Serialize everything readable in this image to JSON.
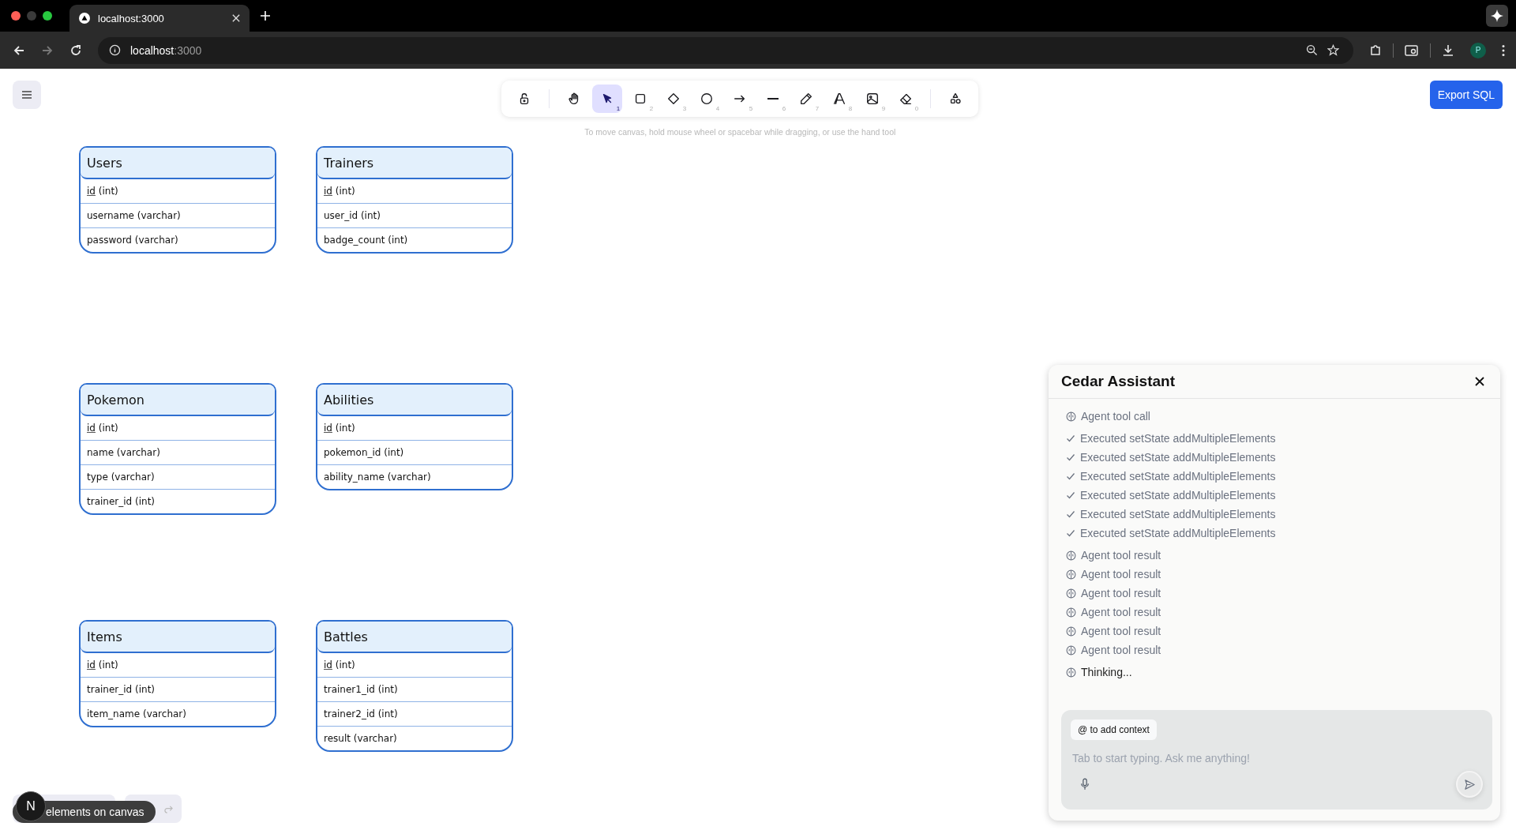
{
  "browser": {
    "tab_title": "localhost:3000",
    "url_host": "localhost",
    "url_port": ":3000",
    "profile_initial": "P"
  },
  "toolbar": {
    "tools": [
      {
        "kind": "lock",
        "selected": false
      },
      {
        "kind": "divider"
      },
      {
        "kind": "hand",
        "selected": false
      },
      {
        "kind": "select",
        "key": "1",
        "selected": true
      },
      {
        "kind": "rectangle",
        "key": "2",
        "selected": false
      },
      {
        "kind": "diamond",
        "key": "3",
        "selected": false
      },
      {
        "kind": "ellipse",
        "key": "4",
        "selected": false
      },
      {
        "kind": "arrow",
        "key": "5",
        "selected": false
      },
      {
        "kind": "line",
        "key": "6",
        "selected": false
      },
      {
        "kind": "pencil",
        "key": "7",
        "selected": false
      },
      {
        "kind": "text",
        "key": "8",
        "selected": false
      },
      {
        "kind": "image",
        "key": "9",
        "selected": false
      },
      {
        "kind": "eraser",
        "key": "0",
        "selected": false
      },
      {
        "kind": "divider"
      },
      {
        "kind": "shapes",
        "selected": false
      }
    ],
    "hint": "To move canvas, hold mouse wheel or spacebar while dragging, or use the hand tool"
  },
  "export_button": "Export SQL",
  "tables": [
    {
      "name": "Users",
      "fields": [
        {
          "name": "id",
          "type": "(int)",
          "primary_key": true
        },
        {
          "name": "username",
          "type": "(varchar)",
          "primary_key": false
        },
        {
          "name": "password",
          "type": "(varchar)",
          "primary_key": false
        }
      ]
    },
    {
      "name": "Trainers",
      "fields": [
        {
          "name": "id",
          "type": "(int)",
          "primary_key": true
        },
        {
          "name": "user_id",
          "type": "(int)",
          "primary_key": false
        },
        {
          "name": "badge_count",
          "type": "(int)",
          "primary_key": false
        }
      ]
    },
    {
      "name": "Pokemon",
      "fields": [
        {
          "name": "id",
          "type": "(int)",
          "primary_key": true
        },
        {
          "name": "name",
          "type": "(varchar)",
          "primary_key": false
        },
        {
          "name": "type",
          "type": "(varchar)",
          "primary_key": false
        },
        {
          "name": "trainer_id",
          "type": "(int)",
          "primary_key": false
        }
      ]
    },
    {
      "name": "Abilities",
      "fields": [
        {
          "name": "id",
          "type": "(int)",
          "primary_key": true
        },
        {
          "name": "pokemon_id",
          "type": "(int)",
          "primary_key": false
        },
        {
          "name": "ability_name",
          "type": "(varchar)",
          "primary_key": false
        }
      ]
    },
    {
      "name": "Items",
      "fields": [
        {
          "name": "id",
          "type": "(int)",
          "primary_key": true
        },
        {
          "name": "trainer_id",
          "type": "(int)",
          "primary_key": false
        },
        {
          "name": "item_name",
          "type": "(varchar)",
          "primary_key": false
        }
      ]
    },
    {
      "name": "Battles",
      "fields": [
        {
          "name": "id",
          "type": "(int)",
          "primary_key": true
        },
        {
          "name": "trainer1_id",
          "type": "(int)",
          "primary_key": false
        },
        {
          "name": "trainer2_id",
          "type": "(int)",
          "primary_key": false
        },
        {
          "name": "result",
          "type": "(varchar)",
          "primary_key": false
        }
      ]
    }
  ],
  "assistant": {
    "title": "Cedar Assistant",
    "messages": [
      {
        "kind": "tool_call",
        "text": "Agent tool call"
      },
      {
        "kind": "executed",
        "text": "Executed setState addMultipleElements"
      },
      {
        "kind": "executed",
        "text": "Executed setState addMultipleElements"
      },
      {
        "kind": "executed",
        "text": "Executed setState addMultipleElements"
      },
      {
        "kind": "executed",
        "text": "Executed setState addMultipleElements"
      },
      {
        "kind": "executed",
        "text": "Executed setState addMultipleElements"
      },
      {
        "kind": "executed",
        "text": "Executed setState addMultipleElements"
      },
      {
        "kind": "tool_result",
        "text": "Agent tool result"
      },
      {
        "kind": "tool_result",
        "text": "Agent tool result"
      },
      {
        "kind": "tool_result",
        "text": "Agent tool result"
      },
      {
        "kind": "tool_result",
        "text": "Agent tool result"
      },
      {
        "kind": "tool_result",
        "text": "Agent tool result"
      },
      {
        "kind": "tool_result",
        "text": "Agent tool result"
      },
      {
        "kind": "thinking",
        "text": "Thinking..."
      }
    ],
    "context_chip": "@ to add context",
    "placeholder": "Tab to start typing. Ask me anything!"
  },
  "canvas_status": {
    "tooltip": "elements on canvas",
    "dev_badge": "N"
  }
}
